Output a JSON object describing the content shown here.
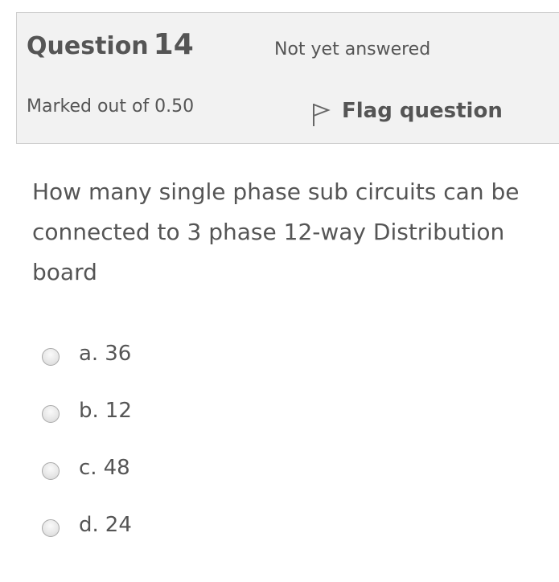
{
  "info": {
    "question_word": "Question",
    "question_number": "14",
    "state": "Not yet answered",
    "grade": "Marked out of 0.50",
    "flag_label": "Flag question",
    "flag_icon": "flag-icon"
  },
  "question": {
    "text": "How many single phase sub circuits can be connected to 3 phase 12-way Distribution board"
  },
  "answers": [
    {
      "letter": "a.",
      "value": "36"
    },
    {
      "letter": "b.",
      "value": "12"
    },
    {
      "letter": "c.",
      "value": "48"
    },
    {
      "letter": "d.",
      "value": "24"
    }
  ]
}
